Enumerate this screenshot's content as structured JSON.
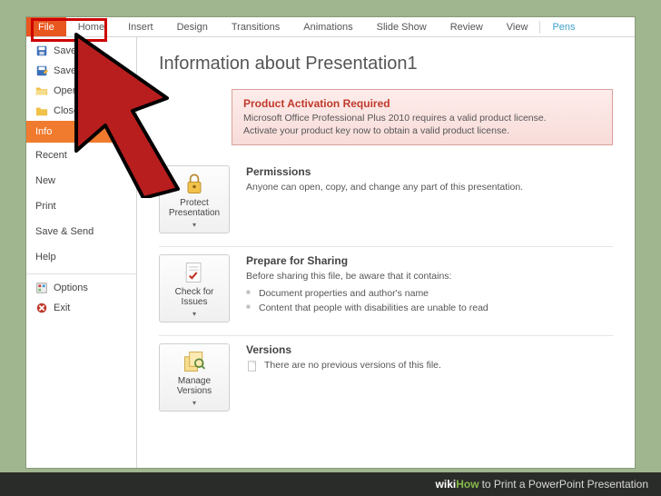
{
  "ribbon": {
    "tabs": [
      "File",
      "Home",
      "Insert",
      "Design",
      "Transitions",
      "Animations",
      "Slide Show",
      "Review",
      "View",
      "Pens"
    ]
  },
  "sidebar": {
    "group1": [
      {
        "icon": "save",
        "label": "Save"
      },
      {
        "icon": "saveas",
        "label": "Save As"
      },
      {
        "icon": "open",
        "label": "Open"
      },
      {
        "icon": "close",
        "label": "Close"
      }
    ],
    "selected": "Info",
    "group2": [
      "Recent",
      "New",
      "Print",
      "Save & Send",
      "Help"
    ],
    "group3": [
      {
        "icon": "options",
        "label": "Options"
      },
      {
        "icon": "exit",
        "label": "Exit"
      }
    ]
  },
  "content": {
    "title": "Information about Presentation1",
    "activation": {
      "title": "Product Activation Required",
      "line1": "Microsoft Office Professional Plus 2010 requires a valid product license.",
      "line2": "Activate your product key now to obtain a valid product license."
    },
    "permissions": {
      "title": "Permissions",
      "text": "Anyone can open, copy, and change any part of this presentation.",
      "btn": "Protect Presentation"
    },
    "prepare": {
      "title": "Prepare for Sharing",
      "text": "Before sharing this file, be aware that it contains:",
      "items": [
        "Document properties and author's name",
        "Content that people with disabilities are unable to read"
      ],
      "btn": "Check for Issues"
    },
    "versions": {
      "title": "Versions",
      "text": "There are no previous versions of this file.",
      "btn": "Manage Versions"
    }
  },
  "watermark": {
    "wiki": "wiki",
    "how": "How",
    "rest": " to Print a PowerPoint Presentation"
  }
}
